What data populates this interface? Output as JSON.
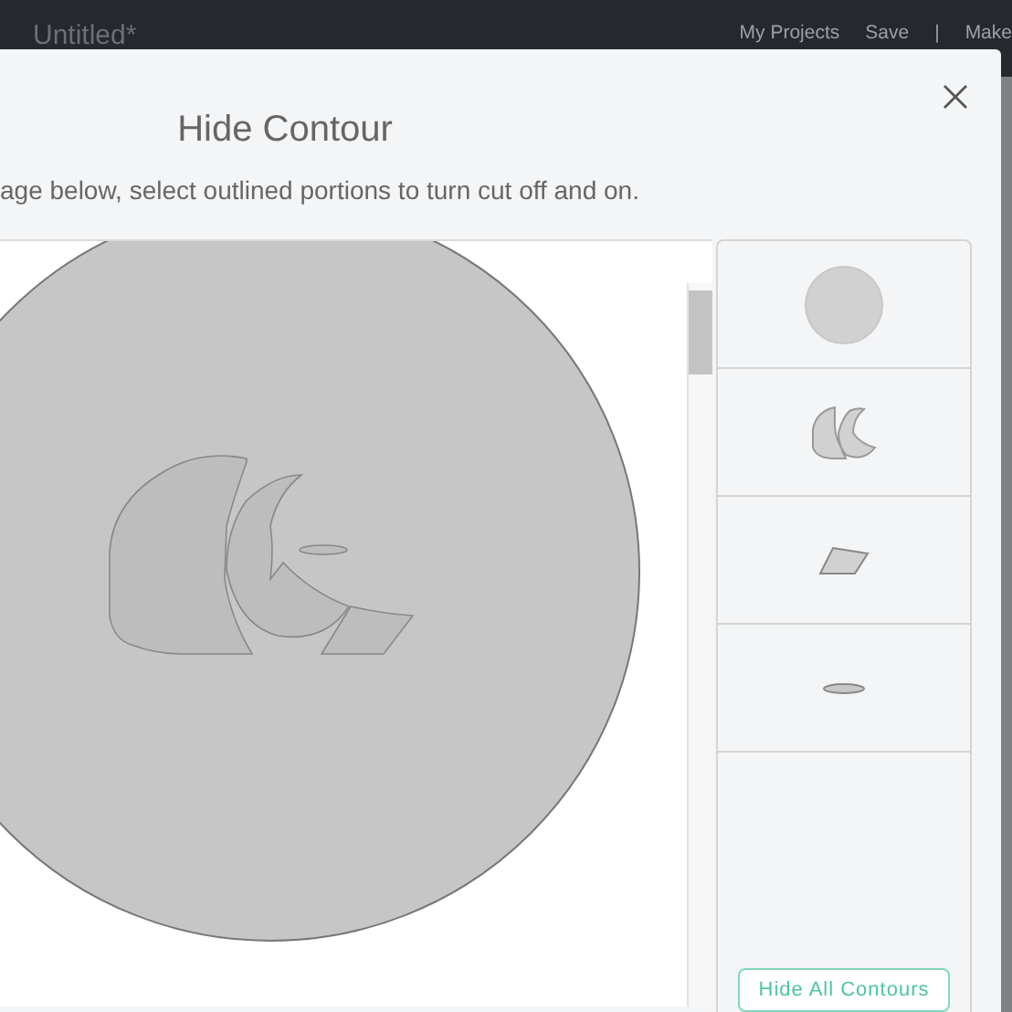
{
  "top_bar": {
    "title": "Untitled*",
    "links": [
      "My Projects",
      "Save",
      "|",
      "Make"
    ]
  },
  "dialog": {
    "title": "Hide Contour",
    "instruction": "age below, select outlined portions to turn cut off and on.",
    "layers": [
      {
        "kind": "circle"
      },
      {
        "kind": "cluster"
      },
      {
        "kind": "shard"
      },
      {
        "kind": "sliver"
      }
    ],
    "button": "Hide All Contours"
  }
}
